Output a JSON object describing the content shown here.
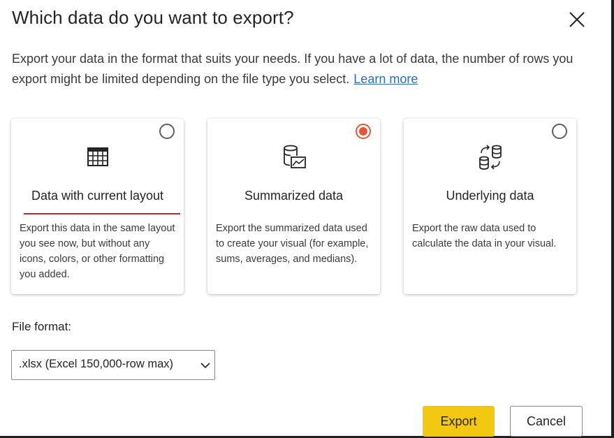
{
  "dialog": {
    "title": "Which data do you want to export?",
    "description": "Export your data in the format that suits your needs. If you have a lot of data, the number of rows you export might be limited depending on the file type you select.",
    "learn_more": "Learn more"
  },
  "options": [
    {
      "title": "Data with current layout",
      "description": "Export this data in the same layout you see now, but without any icons, colors, or other formatting you added.",
      "selected": false,
      "icon": "table-icon"
    },
    {
      "title": "Summarized data",
      "description": "Export the summarized data used to create your visual (for example, sums, averages, and medians).",
      "selected": true,
      "icon": "summarized-data-icon"
    },
    {
      "title": "Underlying data",
      "description": "Export the raw data used to calculate the data in your visual.",
      "selected": false,
      "icon": "underlying-data-icon"
    }
  ],
  "file_format": {
    "label": "File format:",
    "selected": ".xlsx (Excel 150,000-row max)"
  },
  "buttons": {
    "export": "Export",
    "cancel": "Cancel"
  },
  "colors": {
    "accent_radio": "#e8553b",
    "primary_button": "#f2c811",
    "link": "#2b6cc4",
    "focus_underline": "#c4262e"
  }
}
